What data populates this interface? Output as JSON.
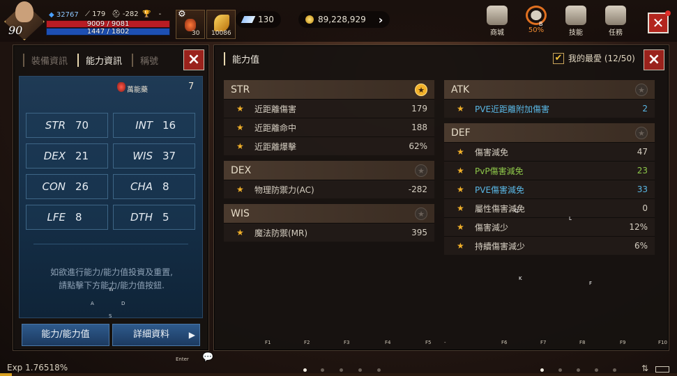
{
  "hud": {
    "level": "90",
    "power": "32767",
    "stat_a": "179",
    "stat_b": "-282",
    "stat_c": "-",
    "hp": "9009 / 9081",
    "mp": "1447 / 1802",
    "slot1_count": "30",
    "slot2_count": "10086",
    "crystal": "130",
    "gold": "89,228,929",
    "menu": [
      {
        "label": "商城",
        "icon": "shop-bag-icon"
      },
      {
        "label": "50%",
        "icon": "bag-icon",
        "badge": "B"
      },
      {
        "label": "技能",
        "icon": "skill-icon"
      },
      {
        "label": "任務",
        "icon": "quest-scroll-icon"
      }
    ]
  },
  "left_panel": {
    "tabs": [
      "裝備資訊",
      "能力資訊",
      "稱號"
    ],
    "active_tab": 1,
    "potion_label": "萬能藥",
    "potion_count": "7",
    "stats": [
      {
        "key": "STR",
        "value": "70"
      },
      {
        "key": "INT",
        "value": "16"
      },
      {
        "key": "DEX",
        "value": "21"
      },
      {
        "key": "WIS",
        "value": "37"
      },
      {
        "key": "CON",
        "value": "26"
      },
      {
        "key": "CHA",
        "value": "8"
      },
      {
        "key": "LFE",
        "value": "8"
      },
      {
        "key": "DTH",
        "value": "5"
      }
    ],
    "help_line1": "如欲進行能力/能力值投資及重置,",
    "help_line2": "請點擊下方能力/能力值按鈕.",
    "dpad": {
      "up": "W",
      "left": "A",
      "right": "D",
      "down": "S"
    },
    "btn_ability": "能力/能力值",
    "btn_detail": "詳細資料"
  },
  "right_panel": {
    "title": "能力值",
    "favorites": "我的最愛 (12/50)",
    "sections_left": [
      {
        "name": "STR",
        "fav": true,
        "rows": [
          {
            "label": "近距離傷害",
            "value": "179",
            "color": "normal"
          },
          {
            "label": "近距離命中",
            "value": "188",
            "color": "normal"
          },
          {
            "label": "近距離爆擊",
            "value": "62%",
            "color": "normal"
          }
        ]
      },
      {
        "name": "DEX",
        "fav": false,
        "rows": [
          {
            "label": "物理防禦力(AC)",
            "value": "-282",
            "color": "normal"
          }
        ]
      },
      {
        "name": "WIS",
        "fav": false,
        "rows": [
          {
            "label": "魔法防禦(MR)",
            "value": "395",
            "color": "normal"
          }
        ]
      }
    ],
    "sections_right": [
      {
        "name": "ATK",
        "fav": false,
        "rows": [
          {
            "label": "PVE近距離附加傷害",
            "value": "2",
            "color": "blue"
          }
        ]
      },
      {
        "name": "DEF",
        "fav": false,
        "rows": [
          {
            "label": "傷害減免",
            "value": "47",
            "color": "normal"
          },
          {
            "label": "PvP傷害減免",
            "value": "23",
            "color": "green"
          },
          {
            "label": "PVE傷害減免",
            "value": "33",
            "color": "blue"
          },
          {
            "label": "屬性傷害減免",
            "value": "0",
            "color": "normal"
          },
          {
            "label": "傷害減少",
            "value": "12%",
            "color": "normal"
          },
          {
            "label": "持續傷害減少",
            "value": "6%",
            "color": "normal"
          }
        ]
      }
    ]
  },
  "overlay_keys": {
    "q": "Q",
    "l": "L",
    "k": "K",
    "f": "F"
  },
  "fkeys": [
    "F1",
    "F2",
    "F3",
    "F4",
    "F5",
    "-",
    "F6",
    "F7",
    "F8",
    "F9",
    "F10"
  ],
  "bottom": {
    "exp": "Exp 1.76518%",
    "exp_fraction": 0.0176518,
    "enter_label": "Enter"
  }
}
